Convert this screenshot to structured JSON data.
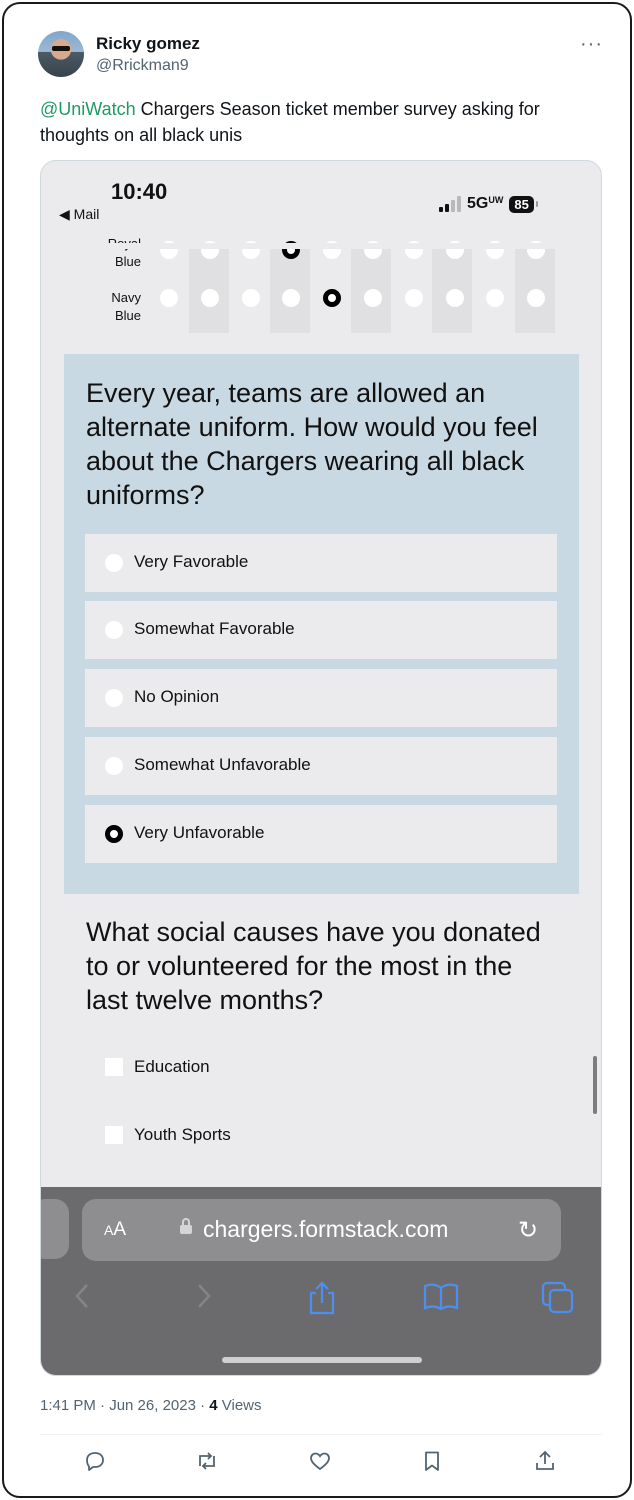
{
  "author": {
    "name": "Ricky gomez",
    "handle": "@Rrickman9"
  },
  "more_label": "···",
  "tweet": {
    "mention": "@UniWatch",
    "text": " Chargers Season ticket member  survey asking for thoughts on all black unis"
  },
  "phone": {
    "time": "10:40",
    "back_label": "◀ Mail",
    "network": "5G",
    "network_suffix": "UW",
    "battery": "85"
  },
  "matrix": {
    "rows": [
      {
        "label": "Royal Blue",
        "label_line1": "Royal",
        "label_line2": "Blue",
        "selected_index": 3
      },
      {
        "label": "Navy Blue",
        "label_line1": "Navy",
        "label_line2": "Blue",
        "selected_index": 4
      }
    ],
    "columns": 10
  },
  "question1": {
    "title": "Every year, teams are allowed an alternate uniform. How would you feel about the Chargers wearing all black uniforms?",
    "options": [
      {
        "label": "Very Favorable",
        "selected": false
      },
      {
        "label": "Somewhat Favorable",
        "selected": false
      },
      {
        "label": "No Opinion",
        "selected": false
      },
      {
        "label": "Somewhat Unfavorable",
        "selected": false
      },
      {
        "label": "Very Unfavorable",
        "selected": true
      }
    ]
  },
  "question2": {
    "title": "What social causes have you donated to or volunteered for the most in the last twelve months?",
    "options": [
      {
        "label": "Education",
        "checked": false
      },
      {
        "label": "Youth Sports",
        "checked": false
      }
    ]
  },
  "safari": {
    "aa_label": "AA",
    "url": "chargers.formstack.com",
    "toolbar_icons": [
      "back-icon",
      "forward-icon",
      "share-icon",
      "bookmarks-icon",
      "tabs-icon"
    ],
    "accent": "#4c8ff0"
  },
  "footer": {
    "timestamp": "1:41 PM · Jun 26, 2023 · ",
    "views_count": "4",
    "views_label": " Views"
  },
  "actions": [
    "reply-icon",
    "retweet-icon",
    "like-icon",
    "bookmark-icon",
    "share-icon"
  ],
  "colors": {
    "mention": "#1d9b66",
    "question_bg": "#c9d9e3",
    "secondary_text": "#536471"
  }
}
